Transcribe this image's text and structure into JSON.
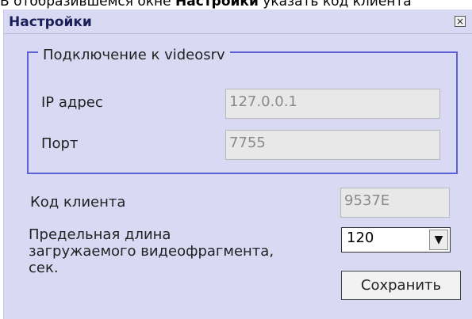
{
  "background_text": {
    "part1": "В отобразившемся окне ",
    "bold": "Настройки",
    "part2": " указать код клиента"
  },
  "window": {
    "title": "Настройки",
    "close_symbol": "×"
  },
  "group": {
    "legend": "Подключение к videosrv",
    "ip_label": "IP адрес",
    "ip_value": "127.0.0.1",
    "port_label": "Порт",
    "port_value": "7755"
  },
  "client": {
    "label": "Код клиента",
    "value": "9537E"
  },
  "max_length": {
    "label_line1": "Предельная длина",
    "label_line2": "загружаемого видеофрагмента,",
    "label_line3": "сек.",
    "selected": "120",
    "arrow": "▼"
  },
  "buttons": {
    "save": "Сохранить"
  },
  "colors": {
    "window_bg": "#d9d9f4",
    "title_text": "#1a1f57",
    "group_border": "#5c62d6"
  }
}
